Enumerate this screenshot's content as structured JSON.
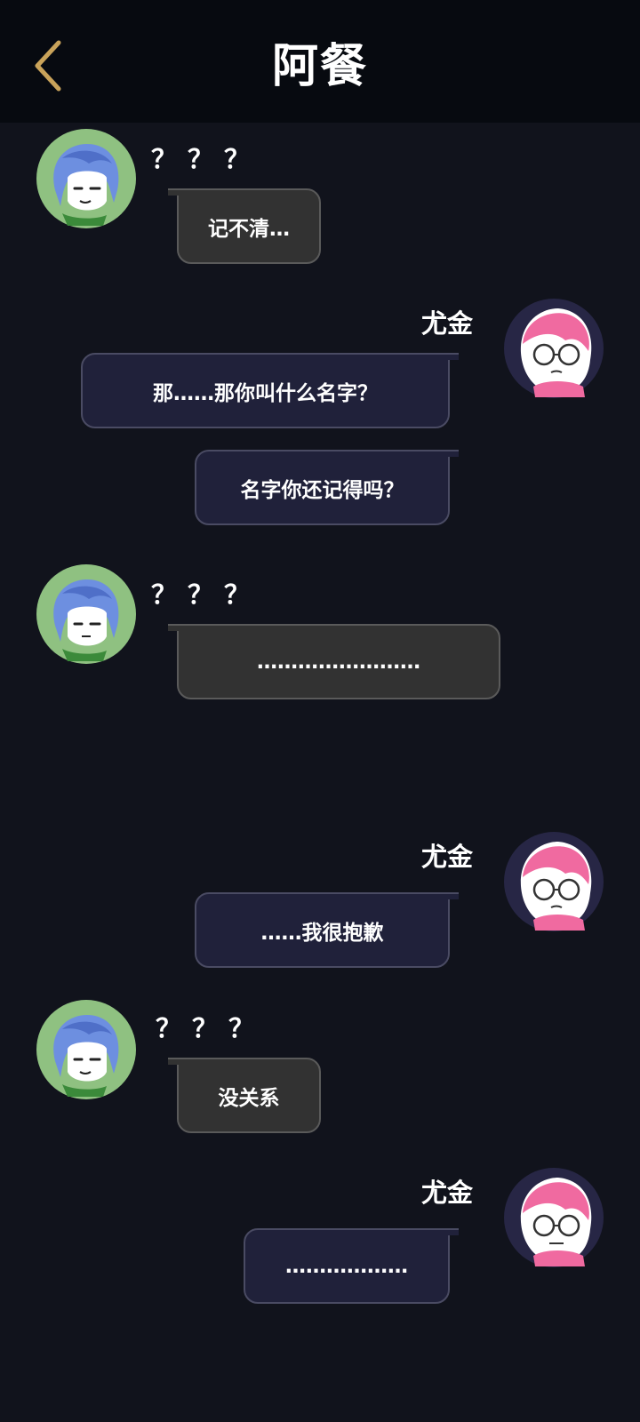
{
  "header": {
    "back_icon": "chevron-left-icon",
    "title": "阿餐"
  },
  "messages": [
    {
      "sender": "？？？",
      "side": "left",
      "texts": [
        "记不清…"
      ]
    },
    {
      "sender": "尤金",
      "side": "right",
      "texts": [
        "那……那你叫什么名字？",
        "名字你还记得吗？"
      ]
    },
    {
      "sender": "？？？",
      "side": "left",
      "texts": [
        "……………………"
      ]
    },
    {
      "sender": "尤金",
      "side": "right",
      "texts": [
        "……我很抱歉"
      ]
    },
    {
      "sender": "？？？",
      "side": "left",
      "texts": [
        "没关系"
      ]
    },
    {
      "sender": "尤金",
      "side": "right",
      "texts": [
        "………………"
      ]
    }
  ],
  "colors": {
    "accent": "#c9a35a",
    "background": "#11131c",
    "left_avatar_bg": "#8fc181",
    "right_avatar_bg": "#272645"
  }
}
